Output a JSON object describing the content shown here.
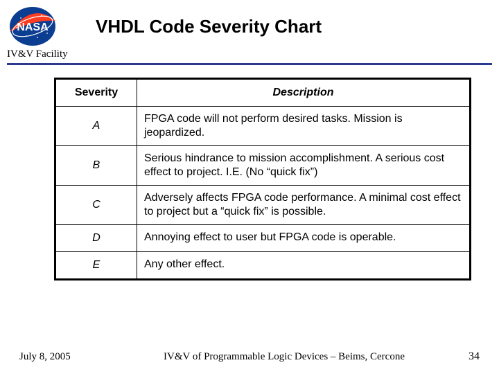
{
  "header": {
    "title": "VHDL Code Severity Chart",
    "facility": "IV&V Facility",
    "logo_text": "NASA"
  },
  "table": {
    "col_severity": "Severity",
    "col_description": "Description",
    "rows": [
      {
        "severity": "A",
        "description": "FPGA code will not perform desired tasks.  Mission is jeopardized."
      },
      {
        "severity": "B",
        "description": "Serious hindrance to mission accomplishment.  A serious cost effect to project. I.E. (No “quick fix”)"
      },
      {
        "severity": "C",
        "description": "Adversely affects FPGA code performance.  A minimal cost effect to project but a “quick fix” is possible."
      },
      {
        "severity": "D",
        "description": "Annoying effect to user but FPGA code is operable."
      },
      {
        "severity": "E",
        "description": "Any other effect."
      }
    ]
  },
  "footer": {
    "date": "July 8, 2005",
    "text": "IV&V of Programmable Logic Devices – Beims, Cercone",
    "page": "34"
  }
}
